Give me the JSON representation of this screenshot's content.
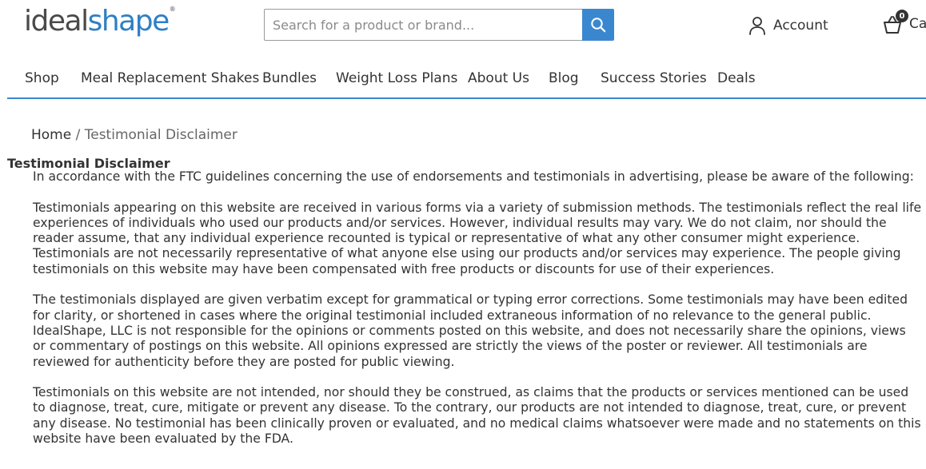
{
  "header": {
    "logo": {
      "ideal": "ideal",
      "shape": "shape",
      "reg": "®"
    },
    "search": {
      "placeholder": "Search for a product or brand..."
    },
    "account_label": "Account",
    "cart": {
      "count": "0",
      "label": "Ca"
    }
  },
  "nav": {
    "items": [
      {
        "label": "Shop"
      },
      {
        "label": "Meal Replacement Shakes"
      },
      {
        "label": "Bundles"
      },
      {
        "label": "Weight Loss Plans"
      },
      {
        "label": "About Us"
      },
      {
        "label": "Blog"
      },
      {
        "label": "Success Stories"
      },
      {
        "label": "Deals"
      }
    ]
  },
  "breadcrumb": {
    "home": "Home",
    "separator": " / ",
    "current": "Testimonial Disclaimer"
  },
  "page": {
    "title": "Testimonial Disclaimer",
    "paragraphs": [
      "In accordance with the FTC guidelines concerning the use of endorsements and testimonials in advertising, please be aware of the following:",
      "Testimonials appearing on this website are received in various forms via a variety of submission methods. The testimonials reflect the real life experiences of individuals who used our products and/or services. However, individual results may vary. We do not claim, nor should the reader assume, that any individual experience recounted is typical or representative of what any other consumer might experience. Testimonials are not necessarily representative of what anyone else using our products and/or services may experience. The people giving testimonials on this website may have been compensated with free products or discounts for use of their experiences.",
      "The testimonials displayed are given verbatim except for grammatical or typing error corrections. Some testimonials may have been edited for clarity, or shortened in cases where the original testimonial included extraneous information of no relevance to the general public. IdealShape, LLC is not responsible for the opinions or comments posted on this website, and does not necessarily share the opinions, views or commentary of postings on this website. All opinions expressed are strictly the views of the poster or reviewer. All testimonials are reviewed for authenticity before they are posted for public viewing.",
      "Testimonials on this website are not intended, nor should they be construed, as claims that the products or services mentioned can be used to diagnose, treat, cure, mitigate or prevent any disease. To the contrary, our products are not intended to diagnose, treat, cure, or prevent any disease. No testimonial has been clinically proven or evaluated, and no medical claims whatsoever were made and no statements on this website have been evaluated by the FDA."
    ]
  },
  "icons": {
    "search": "search-icon",
    "account": "user-icon",
    "cart": "basket-icon"
  },
  "colors": {
    "brand_blue": "#3a87d0",
    "logo_grey": "#4a4a4a",
    "text": "#333333"
  }
}
